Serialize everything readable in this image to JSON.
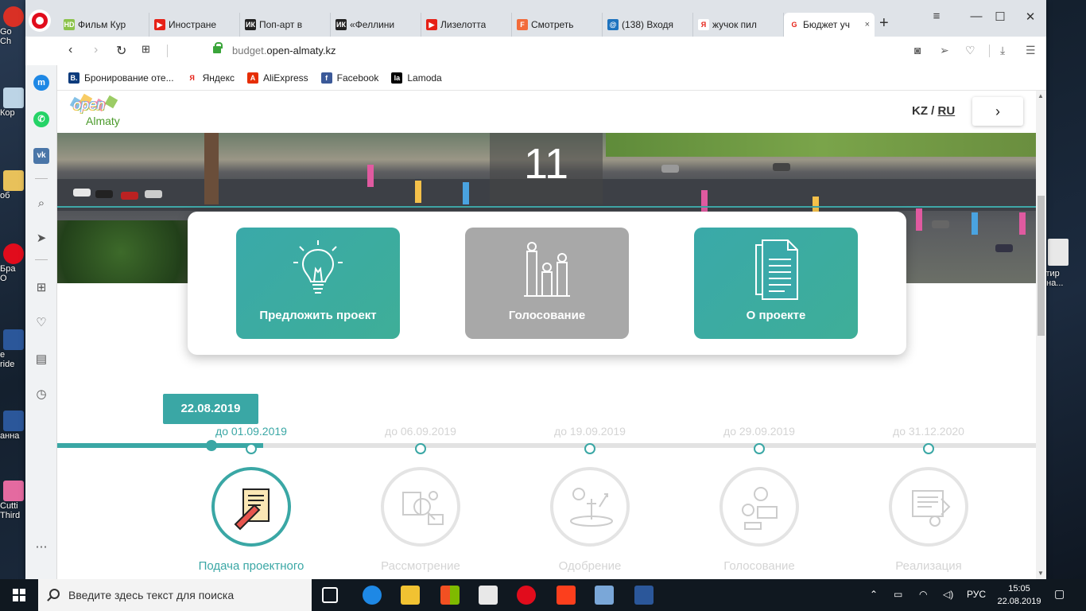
{
  "desktop": {
    "left_labels": [
      "Go",
      "Ch",
      "Кор",
      "об",
      "Бра",
      "O",
      "e",
      "ride",
      "анна",
      "Cutti",
      "Third"
    ],
    "right_label_1": "стир",
    "right_label_2": "она..."
  },
  "browser": {
    "tabs": [
      {
        "label": "Фильм Кур",
        "favicon": "HD",
        "color": "#8bc34a"
      },
      {
        "label": "Иностране",
        "favicon": "▶",
        "color": "#e62117"
      },
      {
        "label": "Поп-арт в",
        "favicon": "ИК",
        "color": "#222222"
      },
      {
        "label": "«Феллини",
        "favicon": "ИК",
        "color": "#222222"
      },
      {
        "label": "Лизелотта",
        "favicon": "▶",
        "color": "#e62117"
      },
      {
        "label": "Смотреть",
        "favicon": "F",
        "color": "#f26b3a"
      },
      {
        "label": "(138) Входя",
        "favicon": "@",
        "color": "#1e73be"
      },
      {
        "label": "жучок пил",
        "favicon": "Я",
        "color": "#ffffff"
      },
      {
        "label": "Бюджет уч",
        "favicon": "G",
        "color": "#ffffff"
      }
    ],
    "active_tab": 8,
    "new_tab": "+",
    "url_domain": "budget.",
    "url_host": "open-almaty.kz",
    "bookmarks": [
      {
        "label": "Бронирование оте...",
        "favicon": "B.",
        "color": "#0c3b7c"
      },
      {
        "label": "Яндекс",
        "favicon": "Я",
        "color": "#ffffff"
      },
      {
        "label": "AliExpress",
        "favicon": "A",
        "color": "#e62e04"
      },
      {
        "label": "Facebook",
        "favicon": "f",
        "color": "#3b5998"
      },
      {
        "label": "Lamoda",
        "favicon": "la",
        "color": "#000000"
      }
    ]
  },
  "site": {
    "logo_open": "open",
    "logo_city": "Almaty",
    "lang_kz": "KZ",
    "lang_sep": "/",
    "lang_ru": "RU",
    "hero_number": "11",
    "actions": [
      {
        "label": "Предложить проект",
        "style": "teal",
        "icon": "lightbulb-icon"
      },
      {
        "label": "Голосование",
        "style": "gray",
        "icon": "podium-icon"
      },
      {
        "label": "О проекте",
        "style": "teal",
        "icon": "document-icon"
      }
    ],
    "current_date": "22.08.2019",
    "progress": 0.21,
    "stages": [
      {
        "until": "до 01.09.2019",
        "name": "Подача проектного предложения",
        "active": true
      },
      {
        "until": "до 06.09.2019",
        "name": "Рассмотрение",
        "active": false
      },
      {
        "until": "до 19.09.2019",
        "name": "Одобрение",
        "active": false
      },
      {
        "until": "до 29.09.2019",
        "name": "Голосование",
        "active": false
      },
      {
        "until": "до 31.12.2020",
        "name": "Реализация",
        "active": false
      }
    ]
  },
  "taskbar": {
    "search_placeholder": "Введите здесь текст для поиска",
    "language": "РУС",
    "time": "15:05",
    "date": "22.08.2019"
  },
  "colors": {
    "accent": "#3aa7a5",
    "inactive": "#d4d4d4"
  }
}
